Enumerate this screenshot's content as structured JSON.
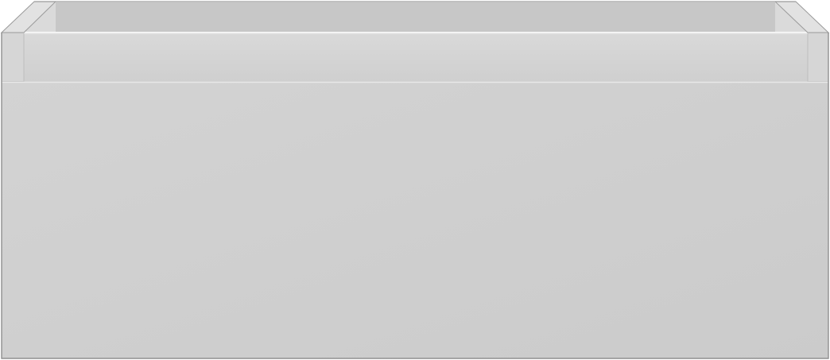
{
  "object": {
    "kind": "drawer-cabinet-render",
    "colors": {
      "background": "#ffffff",
      "front_panel": "#cbcbcb",
      "front_panel_light": "#d3d3d3",
      "rim_front": "#d2d2d2",
      "rim_top_edge": "#e4e4e4",
      "inner_back_wall": "#c6c6c6",
      "inner_side_wall": "#dcdcdc",
      "side_post": "#d6d6d6",
      "shadow_line": "#b9b9b9",
      "outline": "#9a9a9a"
    }
  }
}
